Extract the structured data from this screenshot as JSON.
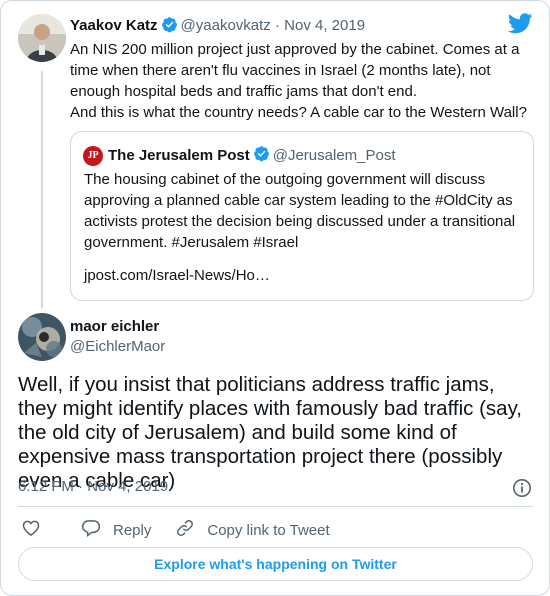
{
  "colors": {
    "accent": "#1d9bf0",
    "text": "#0f1419",
    "muted": "#536471",
    "border": "#cfd9de"
  },
  "tweet1": {
    "name": "Yaakov Katz",
    "handle": "@yaakovkatz",
    "separator": "·",
    "date": "Nov 4, 2019",
    "text_line1": "An NIS 200 million project just approved by the cabinet. Comes at a time when there aren't flu vaccines in Israel (2 months late), not enough hospital beds and traffic jams that don't end.",
    "text_line2": "And this is what the country needs? A cable car to the Western Wall?"
  },
  "quote": {
    "logo_text": "JP",
    "name": "The Jerusalem Post",
    "handle": "@Jerusalem_Post",
    "text": "The housing cabinet of the outgoing government will discuss approving a planned cable car system leading to the #OldCity as activists protest the decision being discussed under a transitional government. #Jerusalem #Israel",
    "link": "jpost.com/Israel-News/Ho…"
  },
  "tweet2": {
    "name": "maor eichler",
    "handle": "@EichlerMaor",
    "text": "Well, if you insist that politicians address traffic jams, they might identify places with famously bad traffic (say, the old city of Jerusalem) and build some kind of expensive mass transportation project there (possibly even a cable car)",
    "time": "6:12 PM",
    "separator": "·",
    "date": "Nov 4, 2019"
  },
  "actions": {
    "reply": "Reply",
    "copy_link": "Copy link to Tweet"
  },
  "explore_button": "Explore what's happening on Twitter",
  "icons": [
    "verified-badge-icon",
    "twitter-bird-icon",
    "info-icon",
    "heart-icon",
    "reply-icon",
    "link-icon"
  ]
}
